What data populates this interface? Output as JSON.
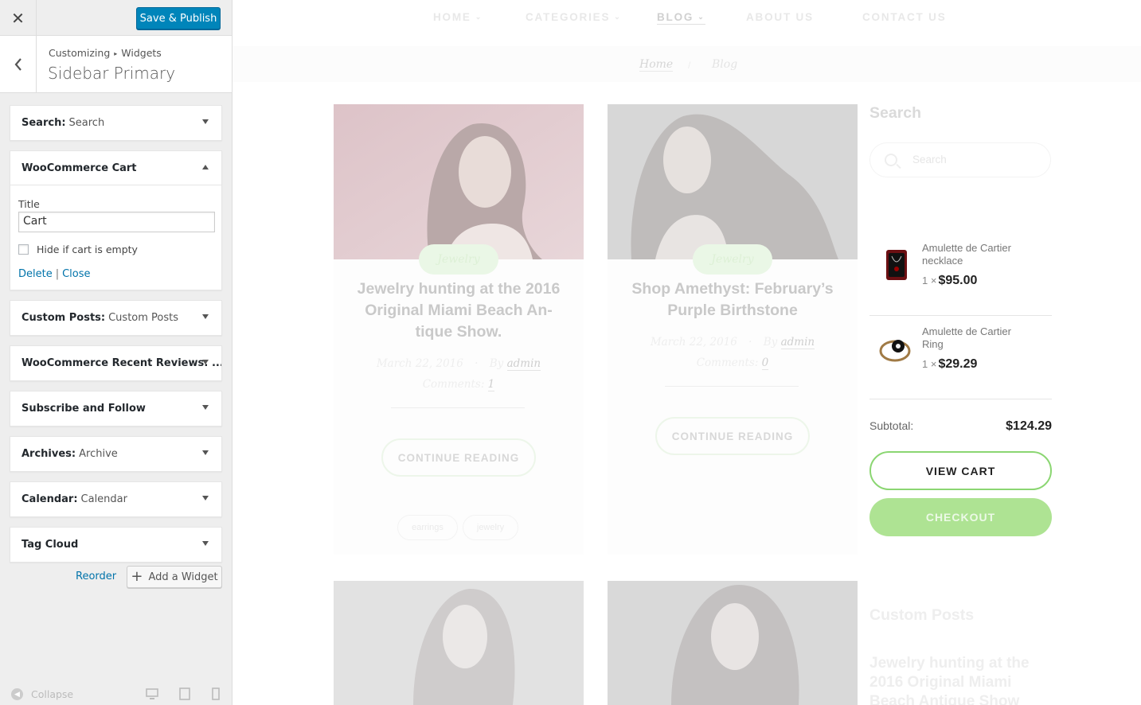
{
  "customizer": {
    "close_glyph": "✕",
    "save_label": "Save & Publish",
    "breadcrumb_root": "Customizing",
    "breadcrumb_sep": "▸",
    "breadcrumb_section": "Widgets",
    "panel_title": "Sidebar Primary",
    "widgets": [
      {
        "name": "Search:",
        "sub": "Search"
      },
      {
        "name": "WooCommerce Cart",
        "sub": ""
      },
      {
        "name": "Custom Posts:",
        "sub": "Custom Posts"
      },
      {
        "name": "WooCommerce Recent Reviews: ...",
        "sub": ""
      },
      {
        "name": "Subscribe and Follow",
        "sub": ""
      },
      {
        "name": "Archives:",
        "sub": "Archive"
      },
      {
        "name": "Calendar:",
        "sub": "Calendar"
      },
      {
        "name": "Tag Cloud",
        "sub": ""
      }
    ],
    "cart_form": {
      "title_label": "Title",
      "title_value": "Cart",
      "hide_label": "Hide if cart is empty",
      "delete_label": "Delete",
      "divider": "|",
      "close_label": "Close"
    },
    "reorder_label": "Reorder",
    "add_widget_label": "Add a Widget",
    "collapse_label": "Collapse"
  },
  "preview": {
    "nav": [
      {
        "label": "HOME",
        "caret": "⌄"
      },
      {
        "label": "CATEGORIES",
        "caret": "⌄"
      },
      {
        "label": "BLOG",
        "caret": "⌄"
      },
      {
        "label": "ABOUT US",
        "caret": ""
      },
      {
        "label": "CONTACT US",
        "caret": ""
      }
    ],
    "breadcrumb": {
      "home": "Home",
      "sep": "/",
      "current": "Blog"
    },
    "posts": [
      {
        "tag": "Jewelry",
        "title": "Jewelry hunting at the 2016 Original Miami Beach An-tique Show.",
        "date": "March 22, 2016",
        "by": "By",
        "author": "admin",
        "comments_label": "Comments:",
        "comments": "1",
        "cta": "CONTINUE READING",
        "tags": [
          "earrings",
          "jewelry"
        ]
      },
      {
        "tag": "Jewelry",
        "title": "Shop Amethyst: February’s Purple Birthstone",
        "date": "March 22, 2016",
        "by": "By",
        "author": "admin",
        "comments_label": "Comments:",
        "comments": "0",
        "cta": "CONTINUE READING"
      }
    ],
    "sidebar": {
      "search_heading": "Search",
      "search_placeholder": "Search",
      "cart_items": [
        {
          "name": "Amulette de Cartier necklace",
          "qty": "1 ×",
          "price": "$95.00"
        },
        {
          "name": "Amulette de Cartier Ring",
          "qty": "1 ×",
          "price": "$29.29"
        }
      ],
      "subtotal_label": "Subtotal:",
      "subtotal_value": "$124.29",
      "view_cart": "VIEW CART",
      "checkout": "CHECKOUT",
      "custom_posts_heading": "Custom Posts",
      "custom_posts_first": "Jewelry hunting at the 2016 Original Miami Beach Antique Show"
    }
  },
  "colors": {
    "accent": "#0085ba",
    "green": "#8bd672",
    "green_fill": "#aee393"
  }
}
